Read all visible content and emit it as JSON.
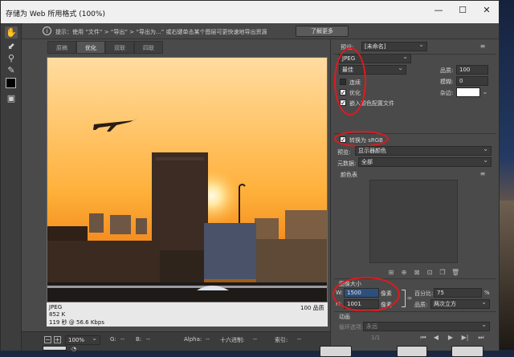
{
  "window": {
    "title": "存储为 Web 所用格式 (100%)",
    "controls": {
      "minimize": "—",
      "maximize": "☐",
      "close": "✕"
    }
  },
  "tipbar": {
    "icon": "info-icon",
    "text": "提示：使用 “文件” > “导出” > “导出为...” 或右键单击某个图层可更快速地导出资源",
    "learn_more": "了解更多"
  },
  "tabs": [
    "原稿",
    "优化",
    "双联",
    "四联"
  ],
  "active_tab": "优化",
  "preview_info": {
    "line1": "JPEG",
    "line2": "852 K",
    "line3": "119 秒 @ 56.6 Kbps",
    "quality": "100 品质"
  },
  "status_bar": {
    "zoom": "100%",
    "g_label": "G:",
    "b_label": "B:",
    "alpha_label": "Alpha:",
    "hex_label": "十六进制:",
    "index_label": "索引:",
    "g_value": "--",
    "b_value": "--",
    "alpha_value": "--",
    "hex_value": "--",
    "index_value": "--"
  },
  "panel": {
    "preset_label": "预设:",
    "preset_value": "[未命名]",
    "format": "JPEG",
    "quality_preset": "最佳",
    "quality_label": "品质:",
    "quality_value": "100",
    "blur_label": "模糊:",
    "blur_value": "0",
    "matte_label": "杂边:",
    "progressive": "连续",
    "progressive_checked": false,
    "optimized": "优化",
    "optimized_checked": true,
    "embed_profile": "嵌入颜色配置文件",
    "embed_checked": true,
    "convert_srgb": "转换为 sRGB",
    "convert_checked": true,
    "preview_label": "预览:",
    "preview_value": "显示器颜色",
    "metadata_label": "元数据:",
    "metadata_value": "全部",
    "color_table_label": "颜色表",
    "image_size_label": "图像大小",
    "width_label": "W:",
    "width_value": "1500",
    "height_label": "H:",
    "height_value": "1001",
    "unit": "像素",
    "percent_label": "百分比:",
    "percent_value": "75",
    "percent_sign": "%",
    "resample_label": "品质:",
    "resample_value": "两次立方",
    "animation_label": "动画",
    "loop_label": "循环选项:",
    "loop_value": "永远",
    "frame_counter": "1/1"
  },
  "colors": {
    "panel_bg": "#4a4a4a",
    "annotation": "#e0191f",
    "sky_top": "#ffd58a",
    "sky_bottom": "#ff8a1c"
  }
}
